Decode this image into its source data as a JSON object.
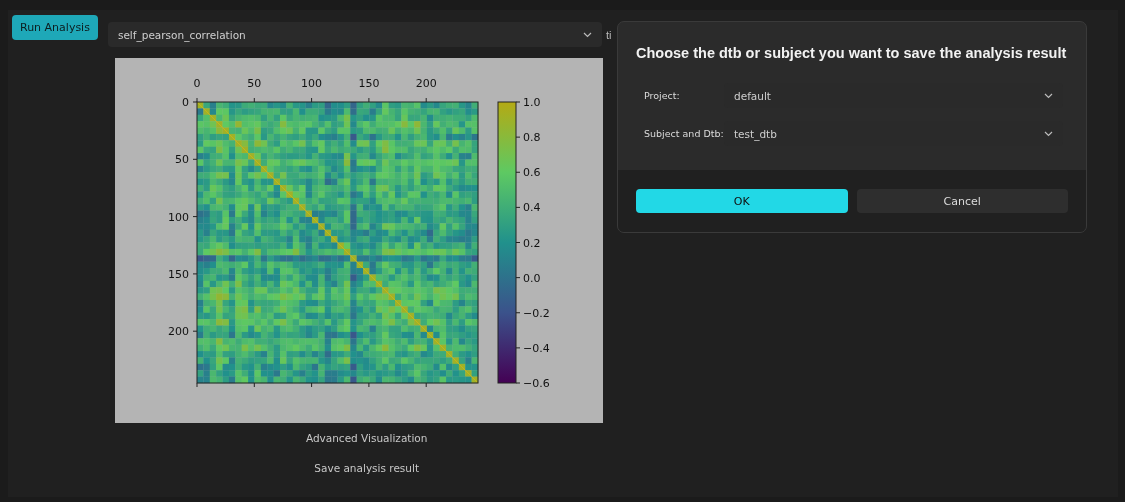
{
  "toolbar": {
    "run_button": "Run Analysis",
    "analysis_select": {
      "value": "self_pearson_correlation"
    },
    "cut_label": "ti"
  },
  "plot": {
    "x_ticks": [
      "0",
      "50",
      "100",
      "150",
      "200"
    ],
    "y_ticks": [
      "0",
      "50",
      "100",
      "150",
      "200"
    ],
    "colorbar_ticks": [
      "1.0",
      "0.8",
      "0.6",
      "0.4",
      "0.2",
      "0.0",
      "−0.2",
      "−0.4",
      "−0.6"
    ]
  },
  "links": [
    "Advanced Visualization",
    "Save analysis result"
  ],
  "dialog": {
    "title": "Choose the dtb or subject you want to save the analysis result",
    "fields": [
      {
        "label": "Project:",
        "value": "default"
      },
      {
        "label": "Subject and Dtb:",
        "value": "test_dtb"
      }
    ],
    "buttons": [
      {
        "label": "OK",
        "primary": true
      },
      {
        "label": "Cancel",
        "primary": false
      }
    ]
  }
}
